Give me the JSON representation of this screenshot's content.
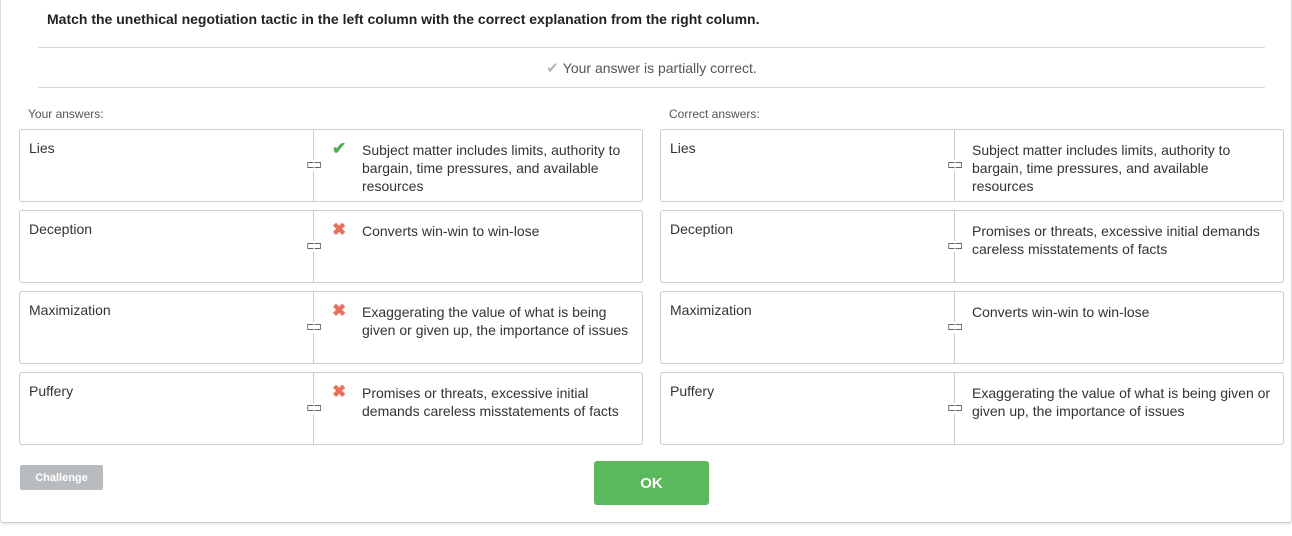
{
  "question": "Match the unethical negotiation tactic in the left column with the correct explanation from the right column.",
  "feedback": {
    "icon": "check-icon",
    "text": "Your answer is partially correct."
  },
  "your_answers": {
    "label": "Your answers:",
    "rows": [
      {
        "term": "Lies",
        "status": "correct",
        "mark": "✔",
        "explanation": "Subject matter includes limits, authority to bargain, time pressures, and available resources"
      },
      {
        "term": "Deception",
        "status": "incorrect",
        "mark": "✖",
        "explanation": "Converts win-win to win-lose"
      },
      {
        "term": "Maximization",
        "status": "incorrect",
        "mark": "✖",
        "explanation": "Exaggerating the value of what is being given or given up, the importance of issues"
      },
      {
        "term": "Puffery",
        "status": "incorrect",
        "mark": "✖",
        "explanation": "Promises or threats, excessive initial demands careless misstatements of facts"
      }
    ]
  },
  "correct_answers": {
    "label": "Correct answers:",
    "rows": [
      {
        "term": "Lies",
        "explanation": "Subject matter includes limits, authority to bargain, time pressures, and available resources"
      },
      {
        "term": "Deception",
        "explanation": "Promises or threats, excessive initial demands careless misstatements of facts"
      },
      {
        "term": "Maximization",
        "explanation": "Converts win-win to win-lose"
      },
      {
        "term": "Puffery",
        "explanation": "Exaggerating the value of what is being given or given up, the importance of issues"
      }
    ]
  },
  "link_icon": {
    "name": "link-icon",
    "glyph": "⊏⊐"
  },
  "buttons": {
    "challenge": "Challenge",
    "ok": "OK"
  },
  "colors": {
    "correct": "#4caf50",
    "incorrect": "#e8705f",
    "ok_button": "#5cb85c",
    "challenge_button": "#b9bcbe"
  }
}
